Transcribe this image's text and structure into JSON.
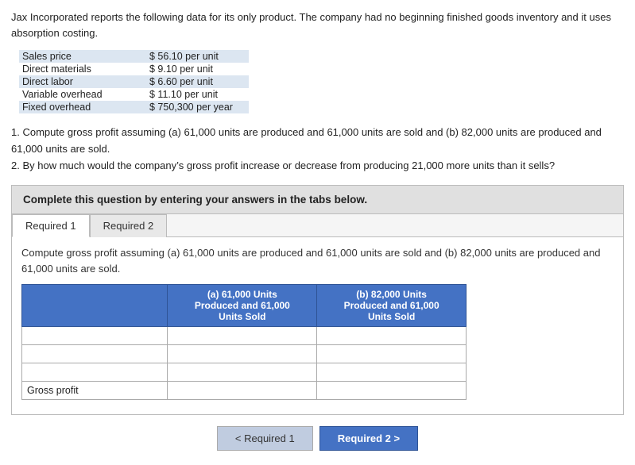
{
  "intro": {
    "text": "Jax Incorporated reports the following data for its only product. The company had no beginning finished goods inventory and it uses absorption costing."
  },
  "cost_data": {
    "rows": [
      {
        "label": "Sales price",
        "value": "$ 56.10 per unit"
      },
      {
        "label": "Direct materials",
        "value": "$ 9.10 per unit"
      },
      {
        "label": "Direct labor",
        "value": "$ 6.60 per unit"
      },
      {
        "label": "Variable overhead",
        "value": "$ 11.10 per unit"
      },
      {
        "label": "Fixed overhead",
        "value": "$ 750,300 per year"
      }
    ]
  },
  "questions": {
    "q1": "1. Compute gross profit assuming (a) 61,000 units are produced and 61,000 units are sold and (b) 82,000 units are produced and 61,000 units are sold.",
    "q2": "2. By how much would the company’s gross profit increase or decrease from producing 21,000 more units than it sells?"
  },
  "complete_box": {
    "text": "Complete this question by entering your answers in the tabs below."
  },
  "tabs": {
    "tab1_label": "Required 1",
    "tab2_label": "Required 2"
  },
  "tab1": {
    "description": "Compute gross profit assuming (a) 61,000 units are produced and 61,000 units are sold and (b) 82,000 units are produced and 61,000 units are sold.",
    "col_a_header_line1": "(a) 61,000 Units",
    "col_a_header_line2": "Produced and 61,000",
    "col_a_header_line3": "Units Sold",
    "col_b_header_line1": "(b) 82,000 Units",
    "col_b_header_line2": "Produced and 61,000",
    "col_b_header_line3": "Units Sold",
    "rows": [
      {
        "label": "",
        "col_a": "",
        "col_b": ""
      },
      {
        "label": "",
        "col_a": "",
        "col_b": ""
      },
      {
        "label": "",
        "col_a": "",
        "col_b": ""
      }
    ],
    "gross_profit_label": "Gross profit"
  },
  "nav": {
    "prev_label": "< Required 1",
    "next_label": "Required 2 >"
  }
}
